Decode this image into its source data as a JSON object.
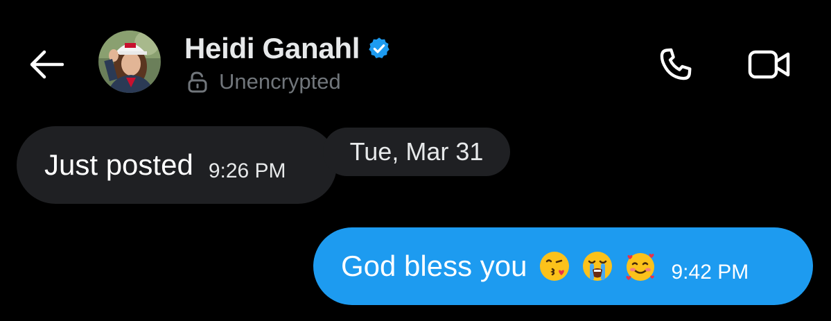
{
  "header": {
    "contact_name": "Heidi Ganahl",
    "encryption_status": "Unencrypted",
    "icons": {
      "back": "back-arrow-icon",
      "verified": "verified-badge-icon",
      "lock": "unlocked-lock-icon",
      "call": "phone-icon",
      "video": "video-camera-icon"
    }
  },
  "messages": [
    {
      "direction": "incoming",
      "text": "Just posted",
      "time": "9:26 PM"
    },
    {
      "direction": "outgoing",
      "text": "God bless you",
      "emojis": [
        "kissing-face-with-heart-emoji",
        "loudly-crying-face-emoji",
        "smiling-face-with-hearts-emoji"
      ],
      "time": "9:42 PM"
    }
  ],
  "date_separator": "Tue, Mar 31",
  "colors": {
    "background": "#000000",
    "incoming_bubble": "#1f2023",
    "outgoing_bubble": "#1d9bf0",
    "verified_badge": "#1d9bf0",
    "secondary_text": "#71767b"
  }
}
